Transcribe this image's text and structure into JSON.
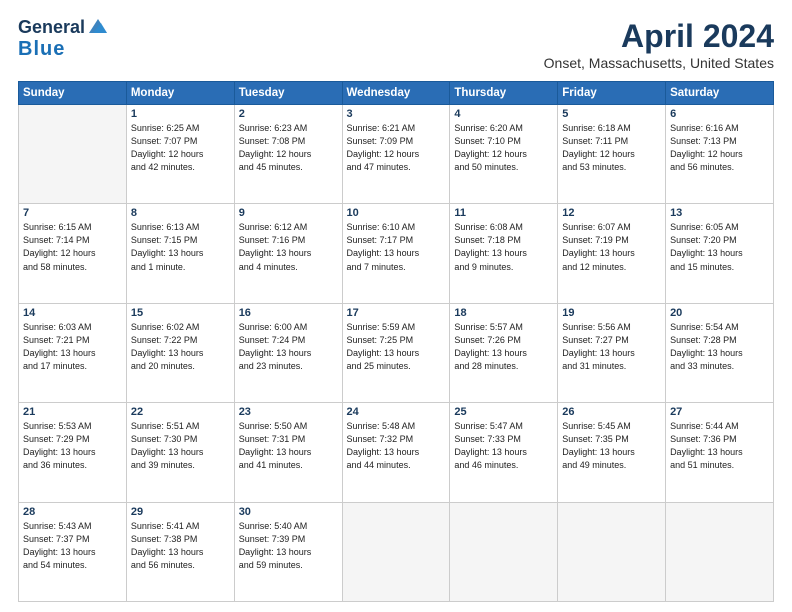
{
  "header": {
    "logo_line1": "General",
    "logo_line2": "Blue",
    "title": "April 2024",
    "subtitle": "Onset, Massachusetts, United States"
  },
  "weekdays": [
    "Sunday",
    "Monday",
    "Tuesday",
    "Wednesday",
    "Thursday",
    "Friday",
    "Saturday"
  ],
  "weeks": [
    [
      {
        "day": "",
        "info": ""
      },
      {
        "day": "1",
        "info": "Sunrise: 6:25 AM\nSunset: 7:07 PM\nDaylight: 12 hours\nand 42 minutes."
      },
      {
        "day": "2",
        "info": "Sunrise: 6:23 AM\nSunset: 7:08 PM\nDaylight: 12 hours\nand 45 minutes."
      },
      {
        "day": "3",
        "info": "Sunrise: 6:21 AM\nSunset: 7:09 PM\nDaylight: 12 hours\nand 47 minutes."
      },
      {
        "day": "4",
        "info": "Sunrise: 6:20 AM\nSunset: 7:10 PM\nDaylight: 12 hours\nand 50 minutes."
      },
      {
        "day": "5",
        "info": "Sunrise: 6:18 AM\nSunset: 7:11 PM\nDaylight: 12 hours\nand 53 minutes."
      },
      {
        "day": "6",
        "info": "Sunrise: 6:16 AM\nSunset: 7:13 PM\nDaylight: 12 hours\nand 56 minutes."
      }
    ],
    [
      {
        "day": "7",
        "info": "Sunrise: 6:15 AM\nSunset: 7:14 PM\nDaylight: 12 hours\nand 58 minutes."
      },
      {
        "day": "8",
        "info": "Sunrise: 6:13 AM\nSunset: 7:15 PM\nDaylight: 13 hours\nand 1 minute."
      },
      {
        "day": "9",
        "info": "Sunrise: 6:12 AM\nSunset: 7:16 PM\nDaylight: 13 hours\nand 4 minutes."
      },
      {
        "day": "10",
        "info": "Sunrise: 6:10 AM\nSunset: 7:17 PM\nDaylight: 13 hours\nand 7 minutes."
      },
      {
        "day": "11",
        "info": "Sunrise: 6:08 AM\nSunset: 7:18 PM\nDaylight: 13 hours\nand 9 minutes."
      },
      {
        "day": "12",
        "info": "Sunrise: 6:07 AM\nSunset: 7:19 PM\nDaylight: 13 hours\nand 12 minutes."
      },
      {
        "day": "13",
        "info": "Sunrise: 6:05 AM\nSunset: 7:20 PM\nDaylight: 13 hours\nand 15 minutes."
      }
    ],
    [
      {
        "day": "14",
        "info": "Sunrise: 6:03 AM\nSunset: 7:21 PM\nDaylight: 13 hours\nand 17 minutes."
      },
      {
        "day": "15",
        "info": "Sunrise: 6:02 AM\nSunset: 7:22 PM\nDaylight: 13 hours\nand 20 minutes."
      },
      {
        "day": "16",
        "info": "Sunrise: 6:00 AM\nSunset: 7:24 PM\nDaylight: 13 hours\nand 23 minutes."
      },
      {
        "day": "17",
        "info": "Sunrise: 5:59 AM\nSunset: 7:25 PM\nDaylight: 13 hours\nand 25 minutes."
      },
      {
        "day": "18",
        "info": "Sunrise: 5:57 AM\nSunset: 7:26 PM\nDaylight: 13 hours\nand 28 minutes."
      },
      {
        "day": "19",
        "info": "Sunrise: 5:56 AM\nSunset: 7:27 PM\nDaylight: 13 hours\nand 31 minutes."
      },
      {
        "day": "20",
        "info": "Sunrise: 5:54 AM\nSunset: 7:28 PM\nDaylight: 13 hours\nand 33 minutes."
      }
    ],
    [
      {
        "day": "21",
        "info": "Sunrise: 5:53 AM\nSunset: 7:29 PM\nDaylight: 13 hours\nand 36 minutes."
      },
      {
        "day": "22",
        "info": "Sunrise: 5:51 AM\nSunset: 7:30 PM\nDaylight: 13 hours\nand 39 minutes."
      },
      {
        "day": "23",
        "info": "Sunrise: 5:50 AM\nSunset: 7:31 PM\nDaylight: 13 hours\nand 41 minutes."
      },
      {
        "day": "24",
        "info": "Sunrise: 5:48 AM\nSunset: 7:32 PM\nDaylight: 13 hours\nand 44 minutes."
      },
      {
        "day": "25",
        "info": "Sunrise: 5:47 AM\nSunset: 7:33 PM\nDaylight: 13 hours\nand 46 minutes."
      },
      {
        "day": "26",
        "info": "Sunrise: 5:45 AM\nSunset: 7:35 PM\nDaylight: 13 hours\nand 49 minutes."
      },
      {
        "day": "27",
        "info": "Sunrise: 5:44 AM\nSunset: 7:36 PM\nDaylight: 13 hours\nand 51 minutes."
      }
    ],
    [
      {
        "day": "28",
        "info": "Sunrise: 5:43 AM\nSunset: 7:37 PM\nDaylight: 13 hours\nand 54 minutes."
      },
      {
        "day": "29",
        "info": "Sunrise: 5:41 AM\nSunset: 7:38 PM\nDaylight: 13 hours\nand 56 minutes."
      },
      {
        "day": "30",
        "info": "Sunrise: 5:40 AM\nSunset: 7:39 PM\nDaylight: 13 hours\nand 59 minutes."
      },
      {
        "day": "",
        "info": ""
      },
      {
        "day": "",
        "info": ""
      },
      {
        "day": "",
        "info": ""
      },
      {
        "day": "",
        "info": ""
      }
    ]
  ]
}
